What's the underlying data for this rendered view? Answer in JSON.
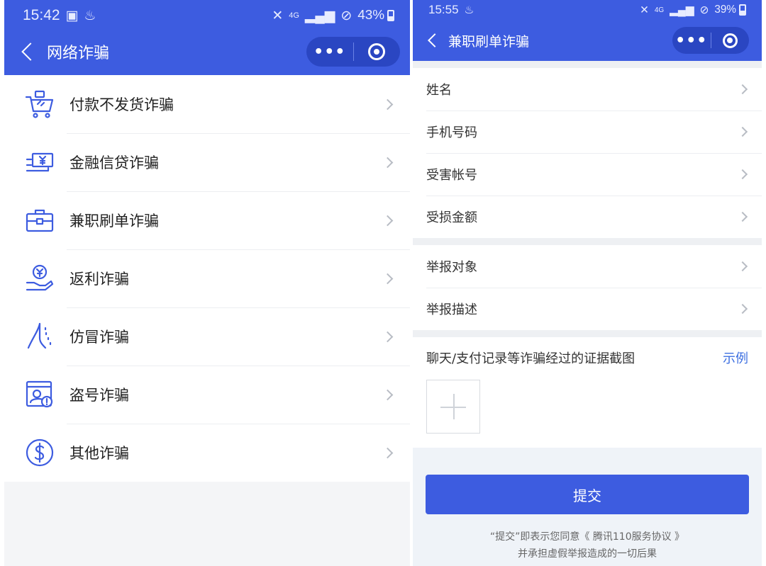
{
  "left": {
    "status": {
      "time": "15:42",
      "battery_text": "43%",
      "signal_text": "4G"
    },
    "title": "网络诈骗",
    "categories": [
      {
        "label": "付款不发货诈骗",
        "icon": "shopping-cart-icon"
      },
      {
        "label": "金融信贷诈骗",
        "icon": "yuan-card-icon"
      },
      {
        "label": "兼职刷单诈骗",
        "icon": "briefcase-icon"
      },
      {
        "label": "返利诈骗",
        "icon": "yuan-hand-icon"
      },
      {
        "label": "仿冒诈骗",
        "icon": "forked-road-icon"
      },
      {
        "label": "盗号诈骗",
        "icon": "account-warning-icon"
      },
      {
        "label": "其他诈骗",
        "icon": "dollar-circle-icon"
      }
    ]
  },
  "right": {
    "status": {
      "time": "15:55",
      "battery_text": "39%",
      "signal_text": "4G"
    },
    "title": "兼职刷单诈骗",
    "fields_group1": [
      "姓名",
      "手机号码",
      "受害帐号",
      "受损金额"
    ],
    "fields_group2": [
      "举报对象",
      "举报描述"
    ],
    "upload_label": "聊天/支付记录等诈骗经过的证据截图",
    "example_link": "示例",
    "submit_label": "提交",
    "agreement_line1": "“提交”即表示您同意《 腾讯110服务协议 》",
    "agreement_line2": "并承担虚假举报造成的一切后果"
  },
  "colors": {
    "brand": "#3d5ce0",
    "capsule": "#2a46c2",
    "link": "#3d6fe0"
  }
}
